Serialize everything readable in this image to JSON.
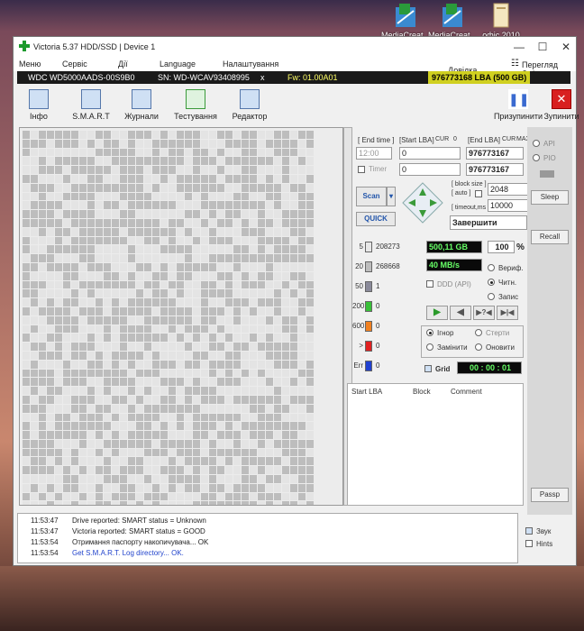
{
  "desktop": {
    "icons": [
      {
        "label": "MediaCreat...",
        "icon": "media-creation-tool-icon"
      },
      {
        "label": "MediaCreat...",
        "icon": "media-creation-tool-icon"
      },
      {
        "label": "офіс 2010",
        "icon": "folder-icon"
      }
    ]
  },
  "window": {
    "title": "Victoria 5.37 HDD/SSD | Device 1",
    "controls": {
      "minimize": "—",
      "maximize": "☐",
      "close": "✕"
    }
  },
  "menu": {
    "items": [
      "Меню",
      "Сервіс",
      "Дії",
      "Language",
      "Налаштування"
    ],
    "help": "Довідка",
    "clipboard": "Перегляд буфера"
  },
  "device": {
    "model": "WDC WD5000AADS-00S9B0",
    "serial": "SN: WD-WCAV93408995",
    "close": "x",
    "firmware": "Fw: 01.00A01",
    "capacity": "976773168 LBA (500 GB)"
  },
  "toolbar": {
    "buttons": [
      {
        "label": "Інфо",
        "icon": "info-icon"
      },
      {
        "label": "S.M.A.R.T",
        "icon": "smart-icon"
      },
      {
        "label": "Журнали",
        "icon": "journals-icon"
      },
      {
        "label": "Тестування",
        "icon": "testing-icon"
      },
      {
        "label": "Редактор",
        "icon": "editor-icon"
      }
    ],
    "pause": "Призупинити",
    "stop": "Зупинити"
  },
  "scan_panel": {
    "end_time_label": "[ End time ]",
    "end_time": "12:00",
    "start_lba_label": "[Start LBA]",
    "cur_label": "CUR",
    "start_cur_value": "0",
    "start_lba": "0",
    "end_lba_label": "[End LBA]",
    "max_label": "MAX",
    "end_lba": "976773167",
    "timer_label": "Timer",
    "timer_value": "0",
    "end_lba_2": "976773167",
    "scan_button": "Scan",
    "quick_button": "QUICK",
    "block_size_label": "[ block size ]",
    "auto_label": "[ auto ]",
    "block_size": "2048",
    "timeout_label": "[ timeout,ms ]",
    "timeout": "10000",
    "action": "Завершити"
  },
  "stats": {
    "scale": [
      {
        "key": "5",
        "count": "208273",
        "color": "#e8e8e8"
      },
      {
        "key": "20",
        "count": "268668",
        "color": "#bdbdbd"
      },
      {
        "key": "50",
        "count": "1",
        "color": "#8a8a9a"
      },
      {
        "key": "200",
        "count": "0",
        "color": "#38c038"
      },
      {
        "key": "600",
        "count": "0",
        "color": "#f08020"
      },
      {
        "key": ">",
        "count": "0",
        "color": "#e02020"
      },
      {
        "key": "Err",
        "count": "0",
        "color": "#2040d0"
      }
    ],
    "position": "500,11 GB",
    "percent": "100",
    "percent_sign": "%",
    "speed": "40 MB/s",
    "ddd": "DDD (API)",
    "verify": "Вериф.",
    "read": "Читн.",
    "write": "Запис",
    "ignore": "Ігнор",
    "erase": "Стерти",
    "remap": "Замінити",
    "refresh": "Оновити",
    "grid_label": "Grid",
    "elapsed": "00 : 00 : 01"
  },
  "table": {
    "headers": [
      "Start LBA",
      "Block",
      "Comment"
    ]
  },
  "sidebar": {
    "api": "API",
    "pio": "PIO",
    "sleep": "Sleep",
    "recall": "Recall",
    "passp": "Passp"
  },
  "log": {
    "lines": [
      {
        "time": "11:53:47",
        "text": "Drive reported: SMART status = Unknown",
        "color": "#222222"
      },
      {
        "time": "11:53:47",
        "text": "Victoria reported: SMART status = GOOD",
        "color": "#222222"
      },
      {
        "time": "11:53:54",
        "text": "Отримання паспорту накопичувача... OK",
        "color": "#222222"
      },
      {
        "time": "11:53:54",
        "text": "Get S.M.A.R.T. Log directory... OK.",
        "color": "#2244cc"
      }
    ],
    "sound": "Звук",
    "hints": "Hints"
  }
}
